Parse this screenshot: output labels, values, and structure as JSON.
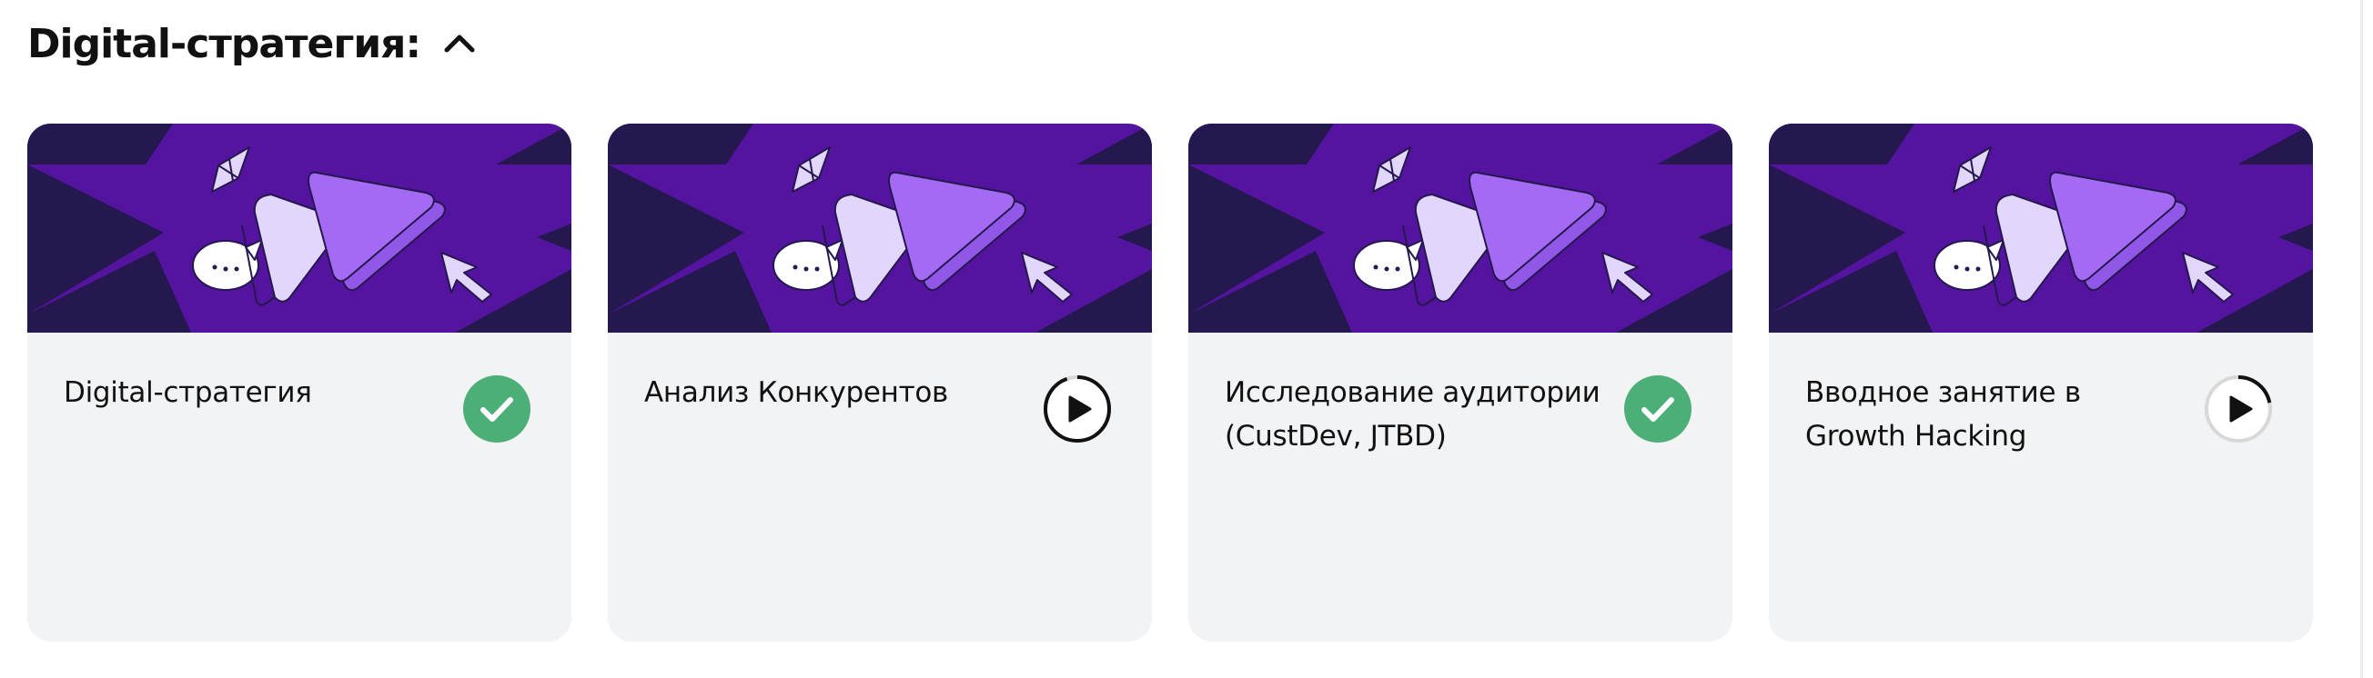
{
  "section": {
    "title": "Digital-стратегия:",
    "toggle_icon": "chevron-up-icon",
    "expanded": true
  },
  "colors": {
    "banner_bg": "#5414a0",
    "banner_dark": "#24184f",
    "play_front": "#a56af4",
    "play_back": "#e3d6fb",
    "completed_green": "#4caf78",
    "card_bg": "#f2f3f5"
  },
  "lessons": [
    {
      "title": "Digital-стратегия",
      "status": "completed",
      "status_icon": "checkmark-icon"
    },
    {
      "title": "Анализ Конкурентов",
      "status": "in-progress",
      "status_icon": "play-icon"
    },
    {
      "title": "Исследование аудитории (CustDev, JTBD)",
      "status": "completed",
      "status_icon": "checkmark-icon"
    },
    {
      "title": "Вводное занятие в Growth Hacking",
      "status": "in-progress",
      "status_icon": "play-icon"
    }
  ]
}
